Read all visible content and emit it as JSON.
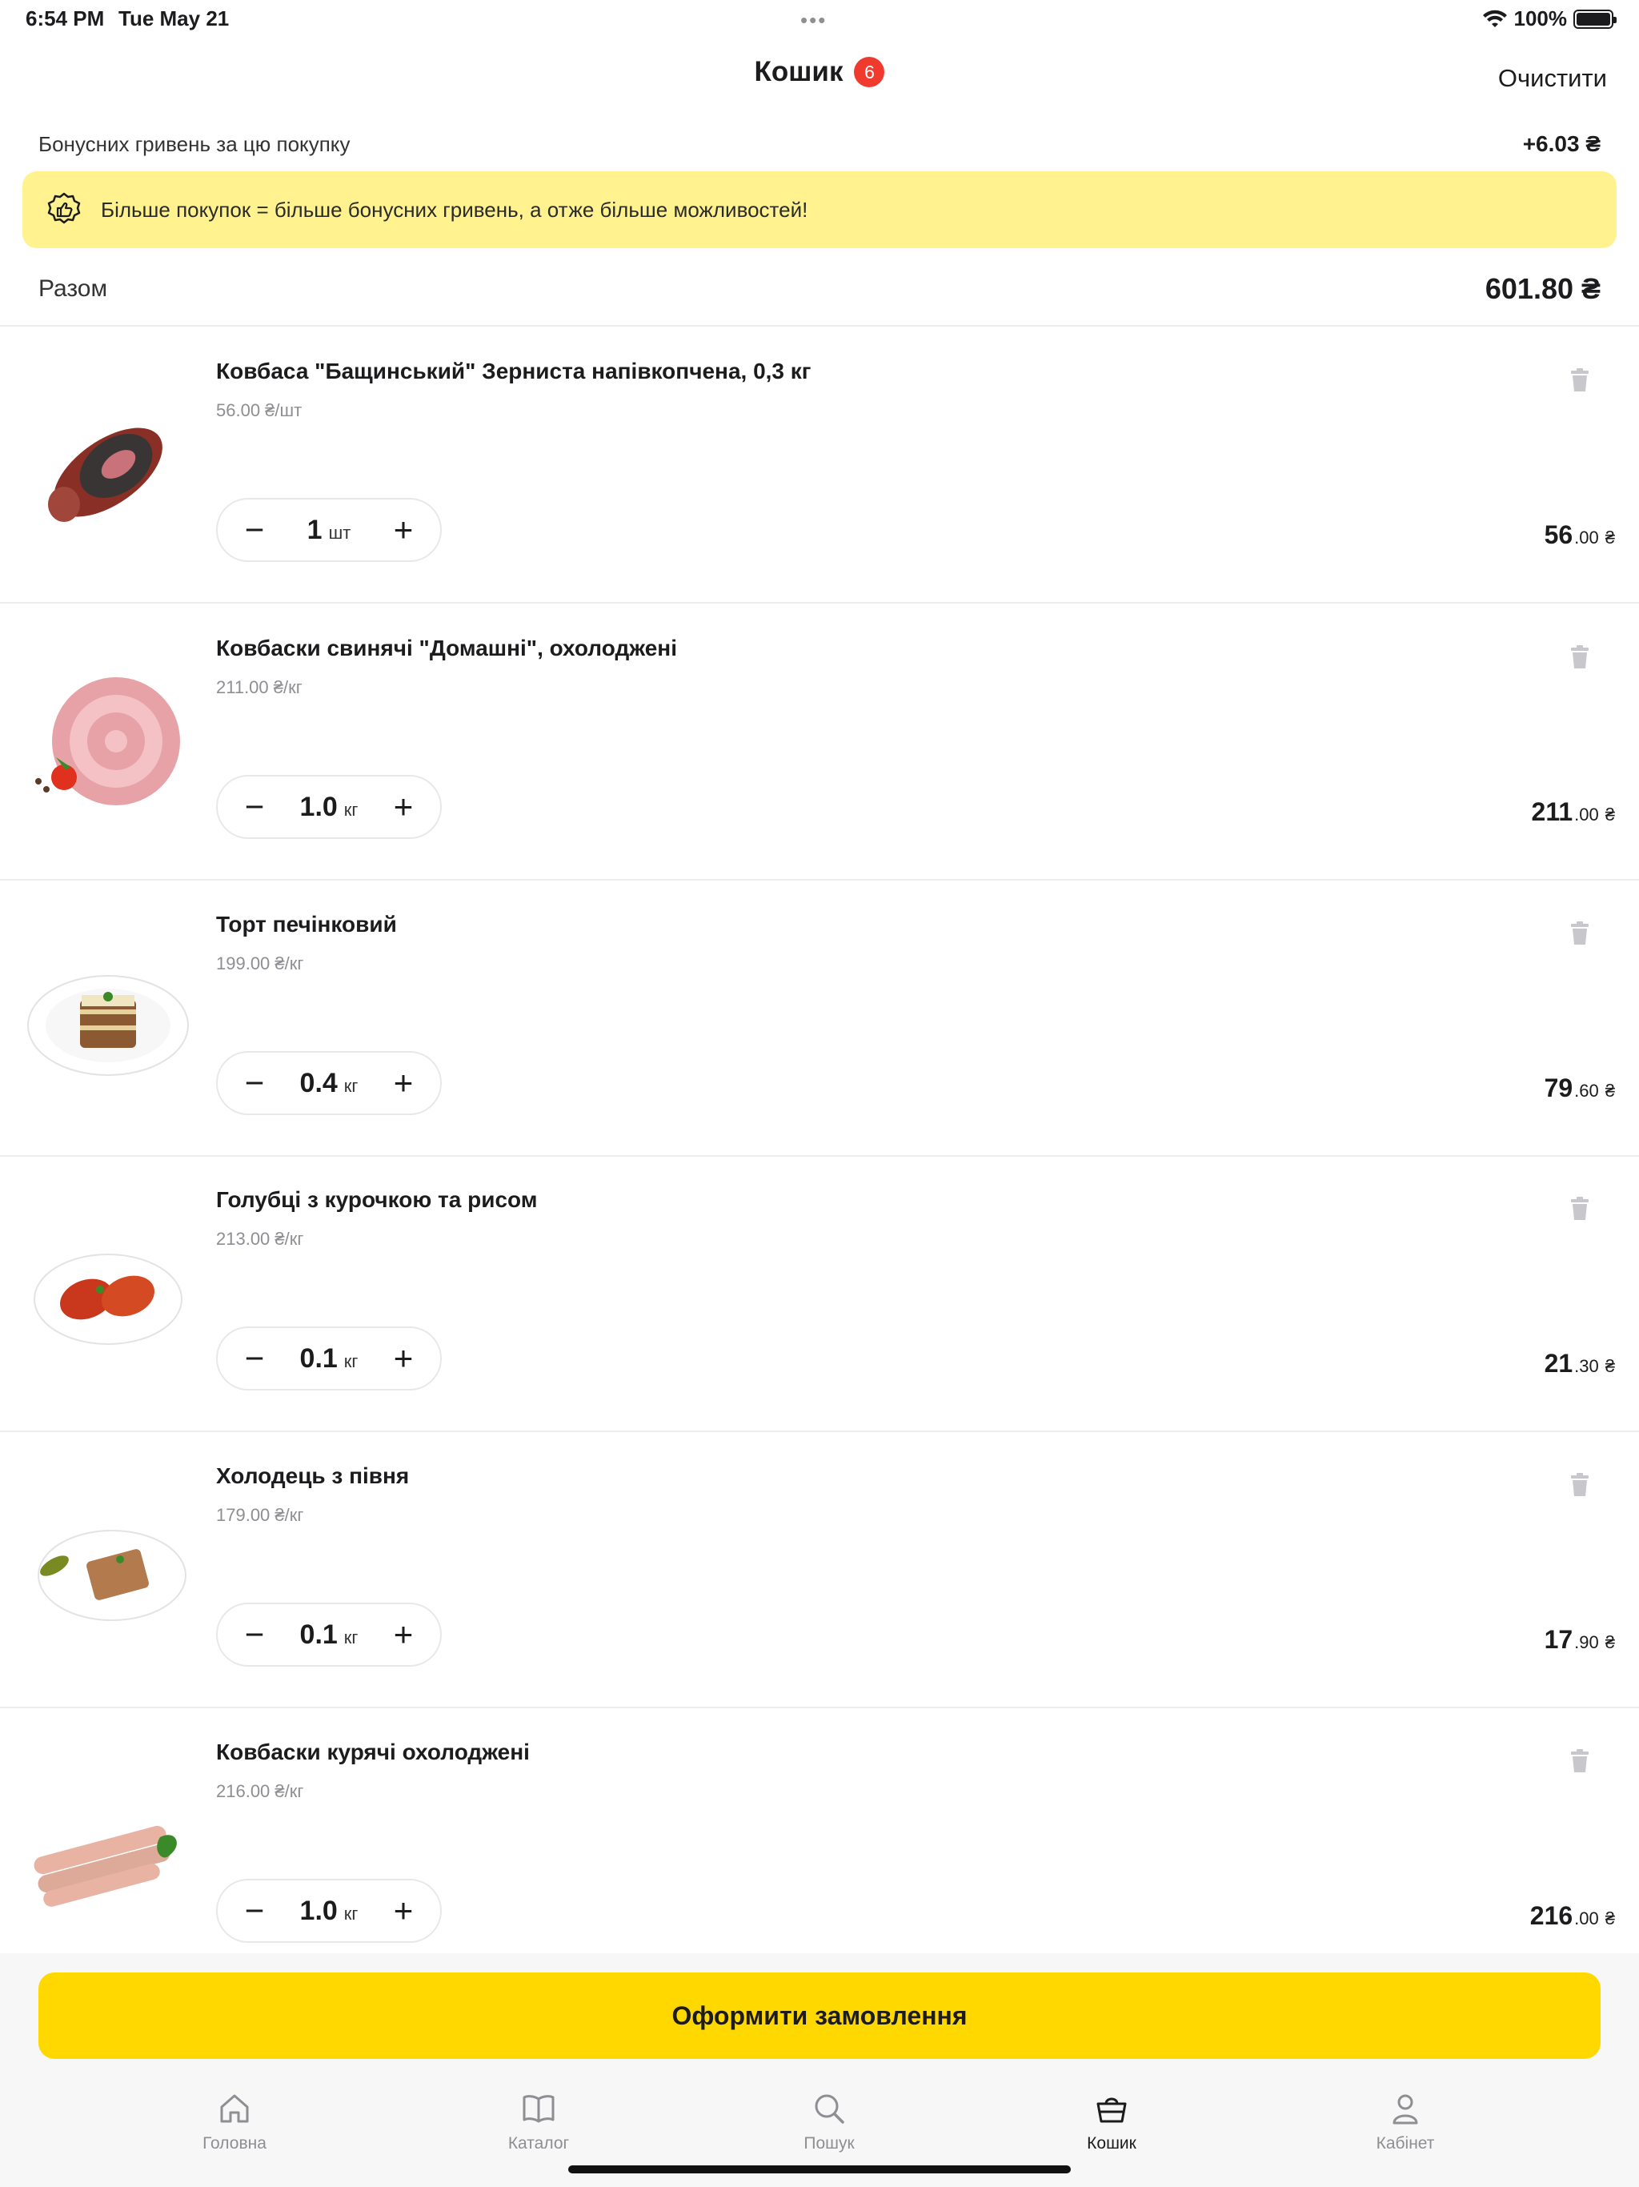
{
  "status_bar": {
    "time": "6:54 PM",
    "date": "Tue May 21",
    "battery": "100%",
    "dots": "•••"
  },
  "header": {
    "title": "Кошик",
    "badge_count": "6",
    "clear_label": "Очистити"
  },
  "bonus": {
    "label": "Бонусних гривень за цю покупку",
    "value": "+6.03 ₴"
  },
  "banner": {
    "text": "Більше покупок = більше бонусних гривень, а отже більше можливостей!",
    "icon": "bonus-badge-icon",
    "bg_color": "#fff28f"
  },
  "total": {
    "label": "Разом",
    "value": "601.80 ₴"
  },
  "stepper": {
    "minus": "−",
    "plus": "+"
  },
  "items": [
    {
      "name": "Ковбаса \"Бащинський\" Зерниста напівкопчена, 0,3 кг",
      "unit_price": "56.00 ₴/шт",
      "qty": "1",
      "unit": "шт",
      "total_main": "56",
      "total_cents": ".00",
      "currency": "₴",
      "image": "sausage-smoked-image"
    },
    {
      "name": "Ковбаски свинячі \"Домашні\", охолоджені",
      "unit_price": "211.00 ₴/кг",
      "qty": "1.0",
      "unit": "кг",
      "total_main": "211",
      "total_cents": ".00",
      "currency": "₴",
      "image": "sausage-coil-image"
    },
    {
      "name": "Торт печінковий",
      "unit_price": "199.00 ₴/кг",
      "qty": "0.4",
      "unit": "кг",
      "total_main": "79",
      "total_cents": ".60",
      "currency": "₴",
      "image": "liver-cake-image"
    },
    {
      "name": "Голубці з курочкою та рисом",
      "unit_price": "213.00 ₴/кг",
      "qty": "0.1",
      "unit": "кг",
      "total_main": "21",
      "total_cents": ".30",
      "currency": "₴",
      "image": "cabbage-rolls-image"
    },
    {
      "name": "Холодець з півня",
      "unit_price": "179.00 ₴/кг",
      "qty": "0.1",
      "unit": "кг",
      "total_main": "17",
      "total_cents": ".90",
      "currency": "₴",
      "image": "aspic-image"
    },
    {
      "name": "Ковбаски курячі охолоджені",
      "unit_price": "216.00 ₴/кг",
      "qty": "1.0",
      "unit": "кг",
      "total_main": "216",
      "total_cents": ".00",
      "currency": "₴",
      "image": "chicken-sausages-image"
    }
  ],
  "order_button": {
    "label": "Оформити замовлення",
    "color": "#ffd800"
  },
  "tabs": [
    {
      "label": "Головна",
      "icon": "home-icon"
    },
    {
      "label": "Каталог",
      "icon": "book-icon"
    },
    {
      "label": "Пошук",
      "icon": "search-icon"
    },
    {
      "label": "Кошик",
      "icon": "basket-icon",
      "active": true
    },
    {
      "label": "Кабінет",
      "icon": "person-icon"
    }
  ],
  "colors": {
    "accent": "#ffd800",
    "badge": "#f03a2e",
    "muted": "#8e8e93"
  }
}
